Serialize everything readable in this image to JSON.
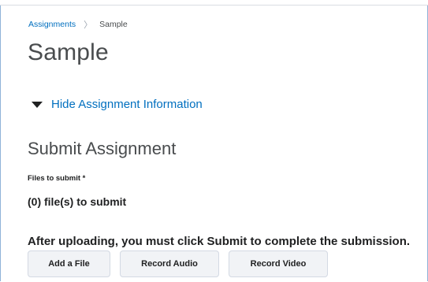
{
  "breadcrumb": {
    "link": "Assignments",
    "separator": "〉",
    "current": "Sample"
  },
  "page_title": "Sample",
  "info_toggle": {
    "label": "Hide Assignment Information"
  },
  "submit_section": {
    "title": "Submit Assignment",
    "files_label": "Files to submit *",
    "files_count": "(0) file(s) to submit",
    "notice": "After uploading, you must click Submit to complete the submission.",
    "buttons": {
      "add_file": "Add a File",
      "record_audio": "Record Audio",
      "record_video": "Record Video"
    }
  },
  "colors": {
    "link": "#006fbf",
    "heading": "#494c4e",
    "button_bg": "#f1f3f6"
  }
}
